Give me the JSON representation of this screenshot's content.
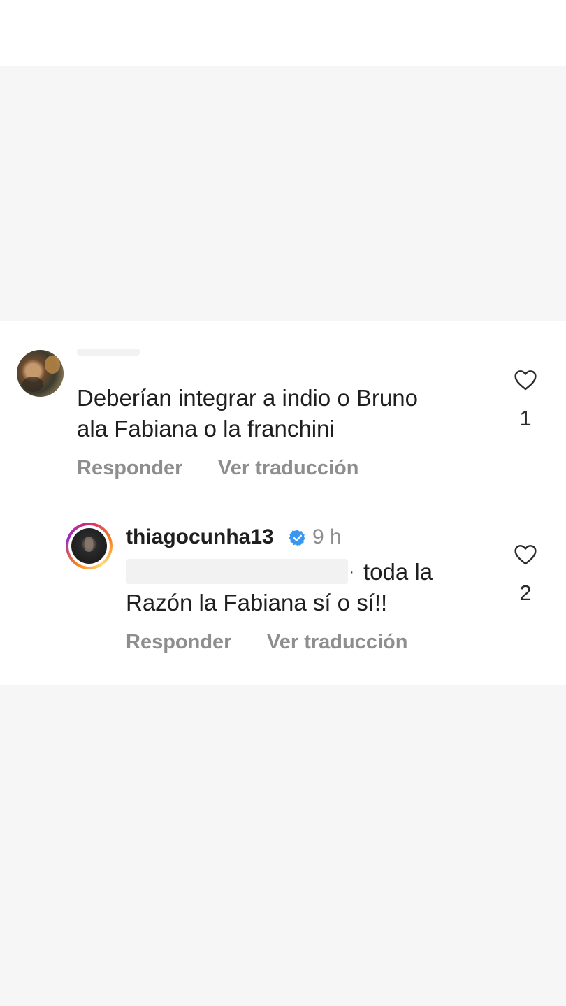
{
  "comments": [
    {
      "text_line1": "Deberían integrar a indio o Bruno",
      "text_line2": "ala Fabiana o la franchini",
      "reply_label": "Responder",
      "translate_label": "Ver traducción",
      "likes": "1"
    },
    {
      "username": "thiagocunha13",
      "time": "9 h",
      "text_line1": "toda la",
      "text_line2": "Razón la Fabiana sí o sí!!",
      "reply_label": "Responder",
      "translate_label": "Ver traducción",
      "likes": "2"
    }
  ],
  "colors": {
    "verified": "#3897f0",
    "secondary_text": "#8e8e8e",
    "story_ring": [
      "#d62976",
      "#fa7e1e",
      "#feda75",
      "#962fbf"
    ]
  },
  "icons": [
    "heart-outline-icon",
    "verified-badge-icon"
  ]
}
